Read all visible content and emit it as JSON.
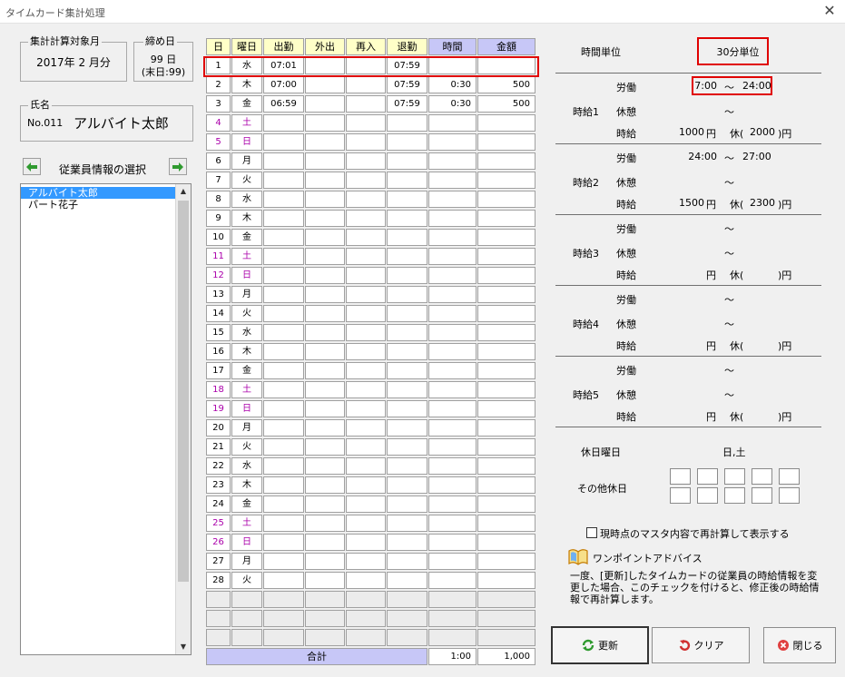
{
  "window": {
    "title": "タイムカード集計処理",
    "close_glyph": "✕"
  },
  "period": {
    "label": "集計計算対象月",
    "value": "2017年 2 月分"
  },
  "closing": {
    "label": "締め日",
    "day": "99 日",
    "note": "(末日:99)"
  },
  "name_group": {
    "label": "氏名",
    "no": "No.011",
    "name": "アルバイト太郎"
  },
  "employee_select": {
    "label": "従業員情報の選択",
    "items": [
      "アルバイト太郎",
      "パート花子"
    ],
    "selected_index": 0
  },
  "grid": {
    "headers": [
      "日",
      "曜日",
      "出勤",
      "外出",
      "再入",
      "退勤",
      "時間",
      "金額"
    ],
    "rows": [
      {
        "day": "1",
        "dow": "水",
        "in": "07:01",
        "out": "",
        "reentry": "",
        "leave": "07:59",
        "hours": "",
        "amount": "",
        "holiday": false
      },
      {
        "day": "2",
        "dow": "木",
        "in": "07:00",
        "out": "",
        "reentry": "",
        "leave": "07:59",
        "hours": "0:30",
        "amount": "500",
        "holiday": false
      },
      {
        "day": "3",
        "dow": "金",
        "in": "06:59",
        "out": "",
        "reentry": "",
        "leave": "07:59",
        "hours": "0:30",
        "amount": "500",
        "holiday": false
      },
      {
        "day": "4",
        "dow": "土",
        "in": "",
        "out": "",
        "reentry": "",
        "leave": "",
        "hours": "",
        "amount": "",
        "holiday": true
      },
      {
        "day": "5",
        "dow": "日",
        "in": "",
        "out": "",
        "reentry": "",
        "leave": "",
        "hours": "",
        "amount": "",
        "holiday": true
      },
      {
        "day": "6",
        "dow": "月",
        "in": "",
        "out": "",
        "reentry": "",
        "leave": "",
        "hours": "",
        "amount": "",
        "holiday": false
      },
      {
        "day": "7",
        "dow": "火",
        "in": "",
        "out": "",
        "reentry": "",
        "leave": "",
        "hours": "",
        "amount": "",
        "holiday": false
      },
      {
        "day": "8",
        "dow": "水",
        "in": "",
        "out": "",
        "reentry": "",
        "leave": "",
        "hours": "",
        "amount": "",
        "holiday": false
      },
      {
        "day": "9",
        "dow": "木",
        "in": "",
        "out": "",
        "reentry": "",
        "leave": "",
        "hours": "",
        "amount": "",
        "holiday": false
      },
      {
        "day": "10",
        "dow": "金",
        "in": "",
        "out": "",
        "reentry": "",
        "leave": "",
        "hours": "",
        "amount": "",
        "holiday": false
      },
      {
        "day": "11",
        "dow": "土",
        "in": "",
        "out": "",
        "reentry": "",
        "leave": "",
        "hours": "",
        "amount": "",
        "holiday": true
      },
      {
        "day": "12",
        "dow": "日",
        "in": "",
        "out": "",
        "reentry": "",
        "leave": "",
        "hours": "",
        "amount": "",
        "holiday": true
      },
      {
        "day": "13",
        "dow": "月",
        "in": "",
        "out": "",
        "reentry": "",
        "leave": "",
        "hours": "",
        "amount": "",
        "holiday": false
      },
      {
        "day": "14",
        "dow": "火",
        "in": "",
        "out": "",
        "reentry": "",
        "leave": "",
        "hours": "",
        "amount": "",
        "holiday": false
      },
      {
        "day": "15",
        "dow": "水",
        "in": "",
        "out": "",
        "reentry": "",
        "leave": "",
        "hours": "",
        "amount": "",
        "holiday": false
      },
      {
        "day": "16",
        "dow": "木",
        "in": "",
        "out": "",
        "reentry": "",
        "leave": "",
        "hours": "",
        "amount": "",
        "holiday": false
      },
      {
        "day": "17",
        "dow": "金",
        "in": "",
        "out": "",
        "reentry": "",
        "leave": "",
        "hours": "",
        "amount": "",
        "holiday": false
      },
      {
        "day": "18",
        "dow": "土",
        "in": "",
        "out": "",
        "reentry": "",
        "leave": "",
        "hours": "",
        "amount": "",
        "holiday": true
      },
      {
        "day": "19",
        "dow": "日",
        "in": "",
        "out": "",
        "reentry": "",
        "leave": "",
        "hours": "",
        "amount": "",
        "holiday": true
      },
      {
        "day": "20",
        "dow": "月",
        "in": "",
        "out": "",
        "reentry": "",
        "leave": "",
        "hours": "",
        "amount": "",
        "holiday": false
      },
      {
        "day": "21",
        "dow": "火",
        "in": "",
        "out": "",
        "reentry": "",
        "leave": "",
        "hours": "",
        "amount": "",
        "holiday": false
      },
      {
        "day": "22",
        "dow": "水",
        "in": "",
        "out": "",
        "reentry": "",
        "leave": "",
        "hours": "",
        "amount": "",
        "holiday": false
      },
      {
        "day": "23",
        "dow": "木",
        "in": "",
        "out": "",
        "reentry": "",
        "leave": "",
        "hours": "",
        "amount": "",
        "holiday": false
      },
      {
        "day": "24",
        "dow": "金",
        "in": "",
        "out": "",
        "reentry": "",
        "leave": "",
        "hours": "",
        "amount": "",
        "holiday": false
      },
      {
        "day": "25",
        "dow": "土",
        "in": "",
        "out": "",
        "reentry": "",
        "leave": "",
        "hours": "",
        "amount": "",
        "holiday": true
      },
      {
        "day": "26",
        "dow": "日",
        "in": "",
        "out": "",
        "reentry": "",
        "leave": "",
        "hours": "",
        "amount": "",
        "holiday": true
      },
      {
        "day": "27",
        "dow": "月",
        "in": "",
        "out": "",
        "reentry": "",
        "leave": "",
        "hours": "",
        "amount": "",
        "holiday": false
      },
      {
        "day": "28",
        "dow": "火",
        "in": "",
        "out": "",
        "reentry": "",
        "leave": "",
        "hours": "",
        "amount": "",
        "holiday": false
      }
    ],
    "empty_rows": 3,
    "total_label": "合計",
    "total_hours": "1:00",
    "total_amount": "1,000"
  },
  "time_unit": {
    "label": "時間単位",
    "value": "30分単位"
  },
  "rates": [
    {
      "name": "時給1",
      "work_label": "労働",
      "work_from": "7:00",
      "work_to": "24:00",
      "break_label": "休憩",
      "break_from": "",
      "break_to": "",
      "rate_label": "時給",
      "rate": "1000",
      "holiday_rate": "2000"
    },
    {
      "name": "時給2",
      "work_label": "労働",
      "work_from": "24:00",
      "work_to": "27:00",
      "break_label": "休憩",
      "break_from": "",
      "break_to": "",
      "rate_label": "時給",
      "rate": "1500",
      "holiday_rate": "2300"
    },
    {
      "name": "時給3",
      "work_label": "労働",
      "work_from": "",
      "work_to": "",
      "break_label": "休憩",
      "break_from": "",
      "break_to": "",
      "rate_label": "時給",
      "rate": "",
      "holiday_rate": ""
    },
    {
      "name": "時給4",
      "work_label": "労働",
      "work_from": "",
      "work_to": "",
      "break_label": "休憩",
      "break_from": "",
      "break_to": "",
      "rate_label": "時給",
      "rate": "",
      "holiday_rate": ""
    },
    {
      "name": "時給5",
      "work_label": "労働",
      "work_from": "",
      "work_to": "",
      "break_label": "休憩",
      "break_from": "",
      "break_to": "",
      "rate_label": "時給",
      "rate": "",
      "holiday_rate": ""
    }
  ],
  "text": {
    "tilde": "～",
    "yen": "円",
    "holiday_open": "休(",
    "holiday_close": ")円"
  },
  "holiday_dow": {
    "label": "休日曜日",
    "value": "日,土"
  },
  "other_holiday": {
    "label": "その他休日"
  },
  "recalc": {
    "label": "現時点のマスタ内容で再計算して表示する",
    "checked": false
  },
  "advice": {
    "title": "ワンポイントアドバイス",
    "body": "一度、[更新]したタイムカードの従業員の時給情報を変更した場合、このチェックを付けると、修正後の時給情報で再計算します。"
  },
  "buttons": {
    "update": "更新",
    "clear": "クリア",
    "close": "閉じる"
  },
  "colors": {
    "highlight": "#e00000",
    "holiday_text": "#aa00aa",
    "header_yellow": "#ffffc8",
    "header_blue": "#c7c7f7",
    "selection": "#3399ff"
  }
}
